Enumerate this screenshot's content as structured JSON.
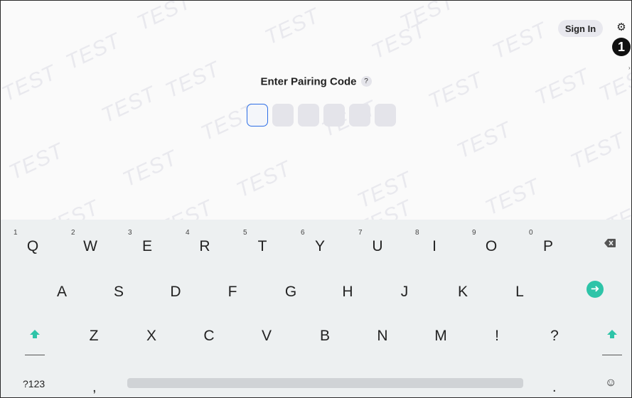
{
  "header": {
    "sign_in_label": "Sign In",
    "badge_number": "1"
  },
  "pairing": {
    "title": "Enter Pairing Code",
    "help": "?",
    "code_length": 6
  },
  "watermark": "TEST",
  "keyboard": {
    "row1": [
      {
        "k": "Q",
        "n": "1"
      },
      {
        "k": "W",
        "n": "2"
      },
      {
        "k": "E",
        "n": "3"
      },
      {
        "k": "R",
        "n": "4"
      },
      {
        "k": "T",
        "n": "5"
      },
      {
        "k": "Y",
        "n": "6"
      },
      {
        "k": "U",
        "n": "7"
      },
      {
        "k": "I",
        "n": "8"
      },
      {
        "k": "O",
        "n": "9"
      },
      {
        "k": "P",
        "n": "0"
      }
    ],
    "row2": [
      "A",
      "S",
      "D",
      "F",
      "G",
      "H",
      "J",
      "K",
      "L"
    ],
    "row3": [
      "Z",
      "X",
      "C",
      "V",
      "B",
      "N",
      "M",
      "!",
      "?"
    ],
    "symbols_label": "?123",
    "comma": ",",
    "period": ".",
    "accent_color": "#2ec4a8",
    "icons": {
      "backspace": "backspace-icon",
      "enter": "enter-arrow-icon",
      "shift": "shift-arrow-icon",
      "emoji": "emoji-icon",
      "settings": "gear-icon"
    }
  }
}
